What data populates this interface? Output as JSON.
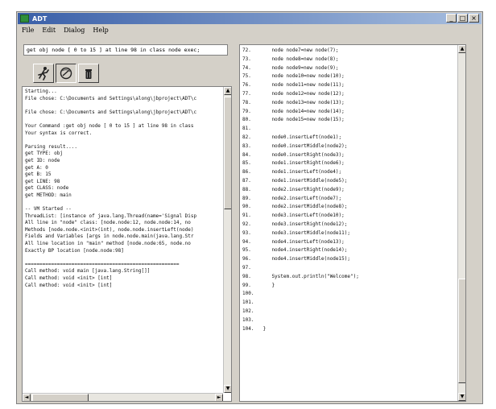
{
  "window": {
    "title": "ADT",
    "minimize": "_",
    "maximize": "□",
    "close": "×"
  },
  "menu": [
    "File",
    "Edit",
    "Dialog",
    "Help"
  ],
  "command_input": "get obj node [ 0 to 15 ] at line 98 in class node exec;",
  "console_lines": [
    "Starting...",
    "File chose: C:\\Documents and Settings\\along\\jbproject\\ADT\\c",
    "",
    "File chose: C:\\Documents and Settings\\along\\jbproject\\ADT\\c",
    "",
    "Your Command :get obj node [ 0 to 15 ] at line 98 in class",
    "Your syntax is correct.",
    "",
    "Parsing result....",
    "get TYPE: obj",
    "get ID: node",
    "get A: 0",
    "get B: 15",
    "get LINE: 98",
    "get CLASS: node",
    "get METHOD: main",
    "",
    "-- VM Started --",
    "ThreadList: [instance of java.lang.Thread(name='Signal Disp",
    "All line in \"node\" class: [node.node:12, node.node:14, no",
    "Methods [node.node.<init>(int), node.node.insertLeft(node)",
    "Fields and Variables [args in node.node.main(java.lang.Str",
    "All line location in \"main\" method [node.node:65, node.no",
    "Exactly BP location [node.node:98]",
    "",
    "=====================================================",
    "Call method: void main [java.lang.String[]]",
    "Call method: void <init> [int]",
    "Call method: void <init> [int]"
  ],
  "code_lines": [
    {
      "n": "72.",
      "t": "    node node7=new node(7);"
    },
    {
      "n": "73.",
      "t": "    node node8=new node(8);"
    },
    {
      "n": "74.",
      "t": "    node node9=new node(9);"
    },
    {
      "n": "75.",
      "t": "    node node10=new node(10);"
    },
    {
      "n": "76.",
      "t": "    node node11=new node(11);"
    },
    {
      "n": "77.",
      "t": "    node node12=new node(12);"
    },
    {
      "n": "78.",
      "t": "    node node13=new node(13);"
    },
    {
      "n": "79.",
      "t": "    node node14=new node(14);"
    },
    {
      "n": "80.",
      "t": "    node node15=new node(15);"
    },
    {
      "n": "81.",
      "t": ""
    },
    {
      "n": "82.",
      "t": "    node0.insertLeft(node1);"
    },
    {
      "n": "83.",
      "t": "    node0.insertMiddle(node2);"
    },
    {
      "n": "84.",
      "t": "    node0.insertRight(node3);"
    },
    {
      "n": "85.",
      "t": "    node1.insertRight(node6);"
    },
    {
      "n": "86.",
      "t": "    node1.insertLeft(node4);"
    },
    {
      "n": "87.",
      "t": "    node1.insertMiddle(node5);"
    },
    {
      "n": "88.",
      "t": "    node2.insertRight(node9);"
    },
    {
      "n": "89.",
      "t": "    node2.insertLeft(node7);"
    },
    {
      "n": "90.",
      "t": "    node2.insertMiddle(node8);"
    },
    {
      "n": "91.",
      "t": "    node3.insertLeft(node10);"
    },
    {
      "n": "92.",
      "t": "    node3.insertRight(node12);"
    },
    {
      "n": "93.",
      "t": "    node3.insertMiddle(node11);"
    },
    {
      "n": "94.",
      "t": "    node4.insertLeft(node13);"
    },
    {
      "n": "95.",
      "t": "    node4.insertRight(node14);"
    },
    {
      "n": "96.",
      "t": "    node4.insertMiddle(node15);"
    },
    {
      "n": "97.",
      "t": ""
    },
    {
      "n": "98.",
      "t": "    System.out.println(\"Welcome\");"
    },
    {
      "n": "99.",
      "t": "    }"
    },
    {
      "n": "100.",
      "t": ""
    },
    {
      "n": "101.",
      "t": ""
    },
    {
      "n": "102.",
      "t": ""
    },
    {
      "n": "103.",
      "t": ""
    },
    {
      "n": "104.",
      "t": " }"
    }
  ],
  "scroll": {
    "up": "▲",
    "down": "▼",
    "left": "◄",
    "right": "►"
  },
  "colors": {
    "title_start": "#3a5fa8",
    "title_end": "#a7bedf",
    "face": "#d4d0c8"
  },
  "icons": {
    "tool1": "run-figure-icon",
    "tool2": "debug-icon",
    "tool3": "trash-icon"
  }
}
